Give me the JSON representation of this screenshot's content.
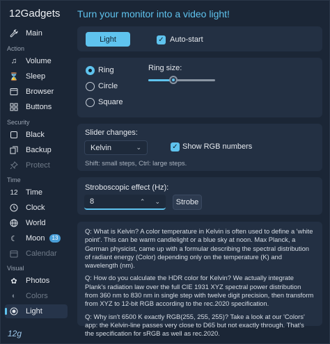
{
  "app": {
    "title": "12Gadgets"
  },
  "sidebar": {
    "main": {
      "label": "Main",
      "icon": "wrench-icon"
    },
    "sections": {
      "action": "Action",
      "security": "Security",
      "time": "Time",
      "visual": "Visual"
    },
    "items": {
      "volume": "Volume",
      "sleep": "Sleep",
      "browser": "Browser",
      "buttons": "Buttons",
      "black": "Black",
      "backup": "Backup",
      "protect": "Protect",
      "time12": "Time",
      "clock": "Clock",
      "world": "World",
      "moon": "Moon",
      "moon_badge": "13",
      "calendar": "Calendar",
      "photos": "Photos",
      "colors": "Colors",
      "light": "Light"
    },
    "time_icon_text": "12",
    "logo_text": "12g"
  },
  "main": {
    "title": "Turn your monitor into a video light!",
    "light_button": "Light",
    "autostart_label": "Auto-start",
    "shape": {
      "ring": "Ring",
      "circle": "Circle",
      "square": "Square",
      "selected": "Ring",
      "ring_size_label": "Ring size:",
      "ring_size_fraction": 0.37
    },
    "slider": {
      "label": "Slider changes:",
      "unit_selected": "Kelvin",
      "show_rgb_label": "Show RGB numbers",
      "hint": "Shift: small steps, Ctrl: large steps."
    },
    "strobe": {
      "label": "Stroboscopic effect (Hz):",
      "value": "8",
      "button": "Strobe"
    },
    "faq": [
      "Q: What is Kelvin? A color temperature in Kelvin is often used to define a 'white point'. This can be warm candlelight or a blue sky at noon. Max Planck, a German physicist, came up with a formular describing the spectral distribution of radiant energy (Color) depending only on the temperature (K) and wavelength (nm).",
      "Q: How do you calculate the HDR color for Kelvin? We actually integrate Plank's radiation law over the full CIE 1931 XYZ spectral power distribution from 360 nm to 830 nm in single step with twelve digit precision, then transform from XYZ to 12-bit RGB according to the rec.2020 specification.",
      "Q: Why isn't 6500 K exactly RGB(255, 255, 255)? Take a look at our 'Colors' app: the Kelvin-line passes very close to D65 but not exactly through. That's the specification for sRGB as well as rec.2020."
    ]
  },
  "colors": {
    "accent": "#5fc3ee",
    "background": "#1b2636",
    "card": "#233043"
  }
}
